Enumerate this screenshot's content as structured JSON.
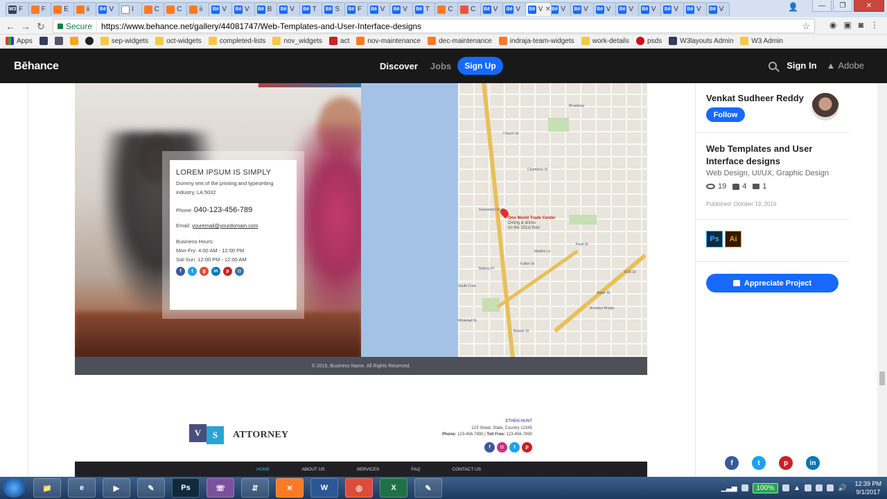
{
  "browser": {
    "active_tab_title": "V",
    "url_secure_label": "Secure",
    "url": "https://www.behance.net/gallery/44081747/Web-Templates-and-User-Interface-designs",
    "tabs": [
      {
        "icon": "w3",
        "label": "F"
      },
      {
        "icon": "xampp",
        "label": "F"
      },
      {
        "icon": "xampp",
        "label": "E"
      },
      {
        "icon": "xampp",
        "label": "ii"
      },
      {
        "icon": "be",
        "label": "V"
      },
      {
        "icon": "doc",
        "label": "I"
      },
      {
        "icon": "xampp",
        "label": "C"
      },
      {
        "icon": "xampp",
        "label": "C"
      },
      {
        "icon": "xampp",
        "label": "ii"
      },
      {
        "icon": "be",
        "label": "V"
      },
      {
        "icon": "be",
        "label": "V"
      },
      {
        "icon": "be",
        "label": "B"
      },
      {
        "icon": "be",
        "label": "V"
      },
      {
        "icon": "be",
        "label": "T"
      },
      {
        "icon": "be",
        "label": "S"
      },
      {
        "icon": "be",
        "label": "F"
      },
      {
        "icon": "be",
        "label": "V"
      },
      {
        "icon": "be",
        "label": "V"
      },
      {
        "icon": "be",
        "label": "T"
      },
      {
        "icon": "xampp",
        "label": "C"
      },
      {
        "icon": "heart",
        "label": "C"
      },
      {
        "icon": "be",
        "label": "V"
      },
      {
        "icon": "be",
        "label": "V"
      },
      {
        "icon": "be",
        "label": "V"
      },
      {
        "icon": "be",
        "label": "V"
      },
      {
        "icon": "be",
        "label": "V"
      },
      {
        "icon": "be",
        "label": "V"
      },
      {
        "icon": "be",
        "label": "V"
      },
      {
        "icon": "be",
        "label": "V"
      },
      {
        "icon": "be",
        "label": "V"
      },
      {
        "icon": "be",
        "label": "V"
      },
      {
        "icon": "be",
        "label": "V"
      }
    ],
    "bookmarks": [
      {
        "icon": "grid",
        "label": "Apps"
      },
      {
        "icon": "w3",
        "label": ""
      },
      {
        "icon": "r",
        "label": ""
      },
      {
        "icon": "q",
        "label": ""
      },
      {
        "icon": "hash",
        "label": ""
      },
      {
        "icon": "folder",
        "label": "sep-widgets"
      },
      {
        "icon": "folder",
        "label": "oct-widgets"
      },
      {
        "icon": "folder",
        "label": "completed-lists"
      },
      {
        "icon": "folder",
        "label": "nov_widgets"
      },
      {
        "icon": "act",
        "label": "act"
      },
      {
        "icon": "x",
        "label": "nov-maintenance"
      },
      {
        "icon": "x",
        "label": "dec-maintenance"
      },
      {
        "icon": "x",
        "label": "indraja-team-widgets"
      },
      {
        "icon": "folder",
        "label": "work-details"
      },
      {
        "icon": "psd",
        "label": "psds"
      },
      {
        "icon": "w3",
        "label": "W3layouts Admin"
      },
      {
        "icon": "folder",
        "label": "W3 Admin"
      }
    ]
  },
  "header": {
    "logo": "Bēhance",
    "discover": "Discover",
    "jobs": "Jobs",
    "signup": "Sign Up",
    "signin": "Sign In",
    "adobe": "Adobe"
  },
  "template": {
    "contact": {
      "title": "LOREM IPSUM IS SIMPLY",
      "text": "Dummy text of the printing and typesetting industry, LA 5032",
      "phone_label": "Phone:",
      "phone": "040-123-456-789",
      "email_label": "Email:",
      "email": "youremail@yourdomain.com",
      "hours_label": "Business Hours:",
      "hours_weekday": "Mon-Fry: 4:00 AM - 12:00 PM",
      "hours_weekend": "Sat-Sun: 12:00 PM - 12:00 AM"
    },
    "map": {
      "pin_title": "One World Trade Center",
      "pin_sub1": "Dining & drinks",
      "pin_sub2": "on the 101st floor",
      "labels": [
        "Chambers St",
        "Church St",
        "Fulton St",
        "Broadway",
        "Water St",
        "South Cove",
        "Pearl St",
        "Battery Pl",
        "Brooklyn Bridge",
        "Greenwich St",
        "Maiden Ln",
        "Beaver St",
        "Whitehall St",
        "FDR Dr"
      ]
    },
    "footer": "© 2015, Business Name. All Rights Reserved.",
    "attorney": {
      "logo_v": "V",
      "logo_s": "S",
      "title": "ATTORNEY",
      "name": "ETHEN HUNT",
      "address": "123 Street, State, Country 12345",
      "phone_label": "Phone:",
      "phone": "123-456-7890",
      "separator": "|",
      "tollfree_label": "Toll Free:",
      "tollfree": "123-456-7890",
      "nav": [
        "HOME",
        "ABOUT US",
        "SERVICES",
        "FAQ",
        "CONTACT US"
      ]
    }
  },
  "sidebar": {
    "owner": "Venkat Sudheer Reddy",
    "follow": "Follow",
    "project_title": "Web Templates and User Interface designs",
    "fields": "Web Design, UI/UX, Graphic Design",
    "views": "19",
    "appreciations": "4",
    "comments": "1",
    "published": "Published: October 19, 2016",
    "tools": [
      "Ps",
      "Ai"
    ],
    "appreciate": "Appreciate Project"
  },
  "taskbar": {
    "battery": "100%",
    "time": "12:39 PM",
    "date": "9/1/2017",
    "apps": [
      "explorer",
      "ie",
      "media",
      "notepad",
      "ps",
      "viber",
      "network",
      "xampp",
      "word",
      "chrome",
      "excel",
      "editor"
    ]
  },
  "colors": {
    "behance_blue": "#1769ff",
    "header_bg": "#191919",
    "footer_bg": "#4d5059"
  }
}
